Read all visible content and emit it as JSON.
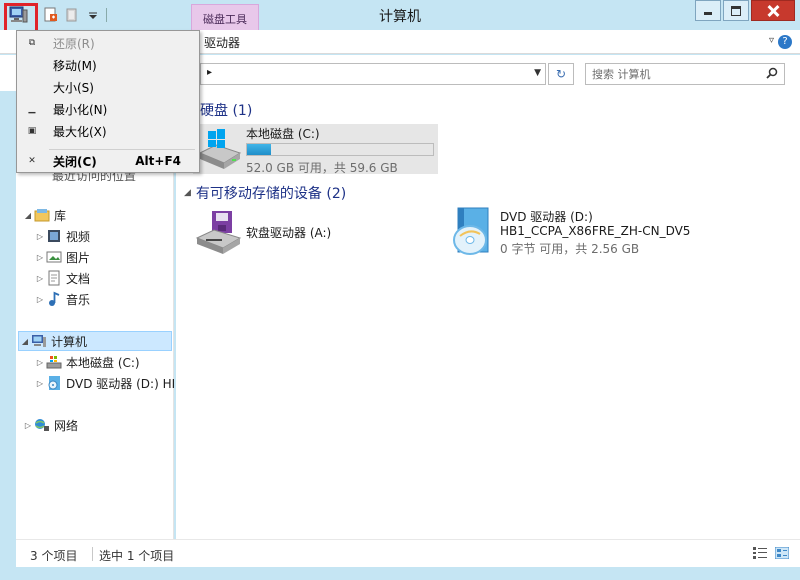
{
  "window": {
    "title": "计算机",
    "context_tab": "磁盘工具"
  },
  "ribbon": {
    "tab_drive": "驱动器",
    "collapse_glyph": "▿"
  },
  "system_menu": {
    "items": [
      {
        "label": "还原(R)",
        "icon": "restore-icon",
        "disabled": true
      },
      {
        "label": "移动(M)",
        "icon": "",
        "disabled": false
      },
      {
        "label": "大小(S)",
        "icon": "",
        "disabled": false
      },
      {
        "label": "最小化(N)",
        "icon": "minimize-icon",
        "disabled": false
      },
      {
        "label": "最大化(X)",
        "icon": "maximize-icon",
        "disabled": false
      },
      {
        "label": "关闭(C)",
        "shortcut": "Alt+F4",
        "icon": "close-icon",
        "disabled": false
      }
    ]
  },
  "address": {
    "chevron": "▸",
    "refresh_glyph": "↻"
  },
  "search": {
    "placeholder": "搜索 计算机"
  },
  "nav": {
    "partial_item": "最近访问的位置",
    "library": "库",
    "videos": "视频",
    "pictures": "图片",
    "documents": "文档",
    "music": "音乐",
    "computer": "计算机",
    "local_disk": "本地磁盘 (C:)",
    "dvd": "DVD 驱动器 (D:) HI",
    "network": "网络"
  },
  "groups": {
    "hard_disks": "硬盘 (1)",
    "removable": "有可移动存储的设备 (2)"
  },
  "drives": {
    "c": {
      "name": "本地磁盘 (C:)",
      "free_text": "52.0 GB 可用，共 59.6 GB",
      "used_fraction": 0.13
    },
    "a": {
      "name": "软盘驱动器 (A:)"
    },
    "d": {
      "name": "DVD 驱动器 (D:)",
      "volume": "HB1_CCPA_X86FRE_ZH-CN_DV5",
      "free_text": "0 字节 可用，共 2.56 GB"
    }
  },
  "status": {
    "count": "3 个项目",
    "selected": "选中 1 个项目"
  },
  "colors": {
    "frame": "#c5e5f3",
    "highlight": "#e0232a",
    "close_button": "#c7392d",
    "group_header": "#1e3287"
  }
}
